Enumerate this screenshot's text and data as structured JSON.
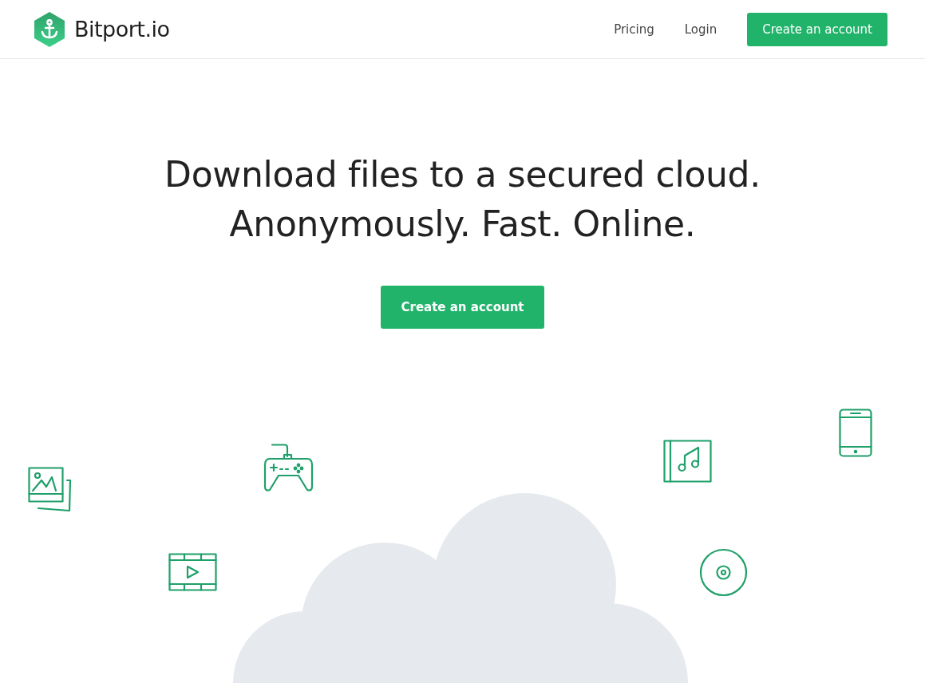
{
  "header": {
    "brand": "Bitport.io",
    "nav": [
      {
        "kind": "link",
        "label": "Pricing"
      },
      {
        "kind": "link",
        "label": "Login"
      },
      {
        "kind": "button",
        "label": "Create an account"
      }
    ]
  },
  "hero": {
    "headline_lines": [
      "Download files to a secured cloud.",
      "Anonymously. Fast. Online."
    ],
    "cta": "Create an account"
  }
}
